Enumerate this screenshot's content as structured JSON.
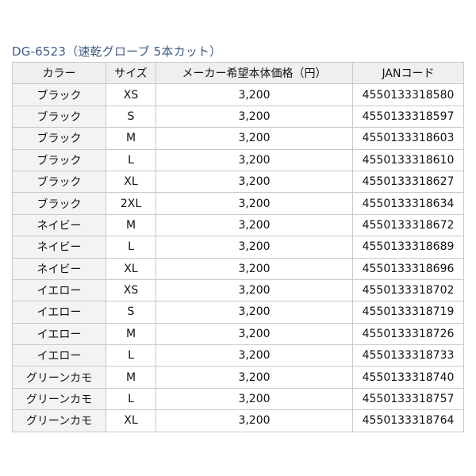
{
  "title": "DG-6523（速乾グローブ 5本カット）",
  "table": {
    "headers": [
      "カラー",
      "サイズ",
      "メーカー希望本体価格（円）",
      "JANコード"
    ],
    "rows": [
      [
        "ブラック",
        "XS",
        "3,200",
        "4550133318580"
      ],
      [
        "ブラック",
        "S",
        "3,200",
        "4550133318597"
      ],
      [
        "ブラック",
        "M",
        "3,200",
        "4550133318603"
      ],
      [
        "ブラック",
        "L",
        "3,200",
        "4550133318610"
      ],
      [
        "ブラック",
        "XL",
        "3,200",
        "4550133318627"
      ],
      [
        "ブラック",
        "2XL",
        "3,200",
        "4550133318634"
      ],
      [
        "ネイビー",
        "M",
        "3,200",
        "4550133318672"
      ],
      [
        "ネイビー",
        "L",
        "3,200",
        "4550133318689"
      ],
      [
        "ネイビー",
        "XL",
        "3,200",
        "4550133318696"
      ],
      [
        "イエロー",
        "XS",
        "3,200",
        "4550133318702"
      ],
      [
        "イエロー",
        "S",
        "3,200",
        "4550133318719"
      ],
      [
        "イエロー",
        "M",
        "3,200",
        "4550133318726"
      ],
      [
        "イエロー",
        "L",
        "3,200",
        "4550133318733"
      ],
      [
        "グリーンカモ",
        "M",
        "3,200",
        "4550133318740"
      ],
      [
        "グリーンカモ",
        "L",
        "3,200",
        "4550133318757"
      ],
      [
        "グリーンカモ",
        "XL",
        "3,200",
        "4550133318764"
      ]
    ]
  },
  "colors": {
    "title": "#3f5a87",
    "header_bg": "#efefef",
    "first_col_bg": "#f3f3f3",
    "border": "#c9c9c9"
  }
}
